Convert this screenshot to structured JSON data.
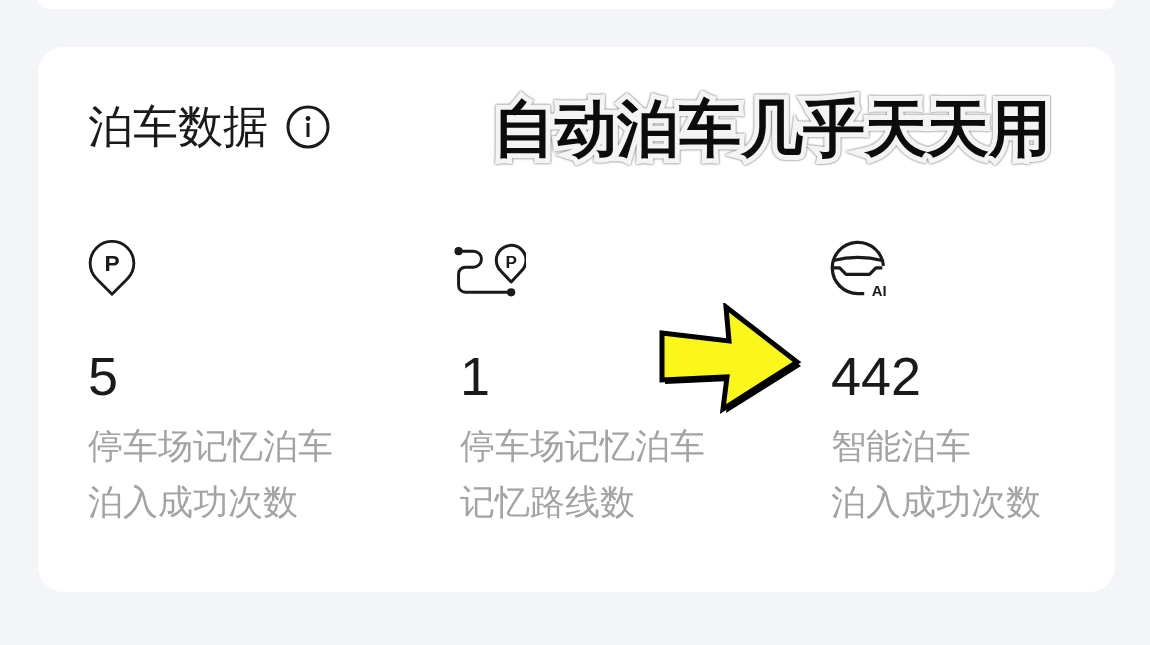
{
  "card": {
    "title": "泊车数据",
    "caption": "自动泊车几乎天天用",
    "stats": [
      {
        "icon": {
          "kind": "pin",
          "text": "P"
        },
        "value": "5",
        "label_lines": [
          "停车场记忆泊车",
          "泊入成功次数"
        ]
      },
      {
        "icon": {
          "kind": "route",
          "text": "P"
        },
        "value": "1",
        "label_lines": [
          "停车场记忆泊车",
          "记忆路线数"
        ]
      },
      {
        "icon": {
          "kind": "ai",
          "text": "AI"
        },
        "value": "442",
        "label_lines": [
          "智能泊车",
          "泊入成功次数"
        ]
      }
    ]
  }
}
